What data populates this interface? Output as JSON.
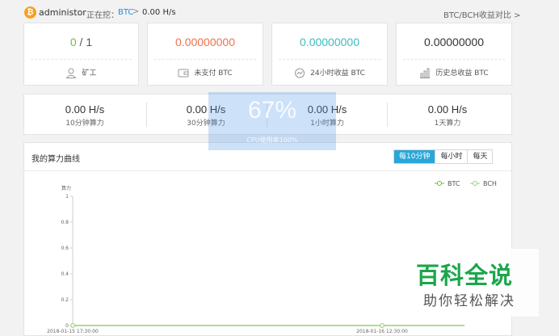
{
  "header": {
    "coin_glyph": "₿",
    "username": "administor",
    "mining_label": "正在挖：",
    "mining_coin": "BTC",
    "breadcrumb_sep": ">",
    "mining_rate": "0.00 H/s",
    "compare_link": "BTC/BCH收益对比 >"
  },
  "stats": [
    {
      "value_left": "0",
      "value_sep": " / ",
      "value_right": "1",
      "label": "矿工",
      "icon": "miner-icon"
    },
    {
      "value": "0.00000000",
      "label": "未支付 BTC",
      "icon": "wallet-icon",
      "color": "#f0724a"
    },
    {
      "value": "0.00000000",
      "label": "24小时收益 BTC",
      "icon": "trend-icon",
      "color": "#3cbcc0"
    },
    {
      "value": "0.00000000",
      "label": "历史总收益 BTC",
      "icon": "history-icon",
      "color": "#333333"
    }
  ],
  "stat_colors": {
    "left": "#6cbf3b",
    "right": "#555555"
  },
  "hashrates": [
    {
      "value": "0.00 H/s",
      "label": "10分钟算力"
    },
    {
      "value": "0.00 H/s",
      "label": "30分钟算力"
    },
    {
      "value": "0.00 H/s",
      "label": "1小时算力"
    },
    {
      "value": "0.00 H/s",
      "label": "1天算力"
    }
  ],
  "overlay": {
    "percent": "67%",
    "subtext": "CPU使用率100%"
  },
  "chart_panel": {
    "title": "我的算力曲线",
    "tabs": [
      {
        "label": "每10分钟",
        "active": true
      },
      {
        "label": "每小时",
        "active": false
      },
      {
        "label": "每天",
        "active": false
      }
    ]
  },
  "chart_data": {
    "type": "line",
    "ylabel": "算力",
    "ylim": [
      0,
      1
    ],
    "yticks": [
      "0",
      "0.2",
      "0.4",
      "0.6",
      "0.8",
      "1"
    ],
    "x_tick_labels": [
      "2018-01-15 17:30:00",
      "2018-01-16 12:30:00"
    ],
    "x": [
      "2018-01-15 17:30:00",
      "2018-01-16 12:30:00"
    ],
    "legend": "top-right",
    "grid": false,
    "series": [
      {
        "name": "BTC",
        "values": [
          0,
          0
        ],
        "color": "#6cbf3b"
      },
      {
        "name": "BCH",
        "values": [
          0,
          0
        ],
        "color": "#9bd26e"
      }
    ]
  },
  "watermark": {
    "title": "百科全说",
    "subtitle": "助你轻松解决"
  }
}
